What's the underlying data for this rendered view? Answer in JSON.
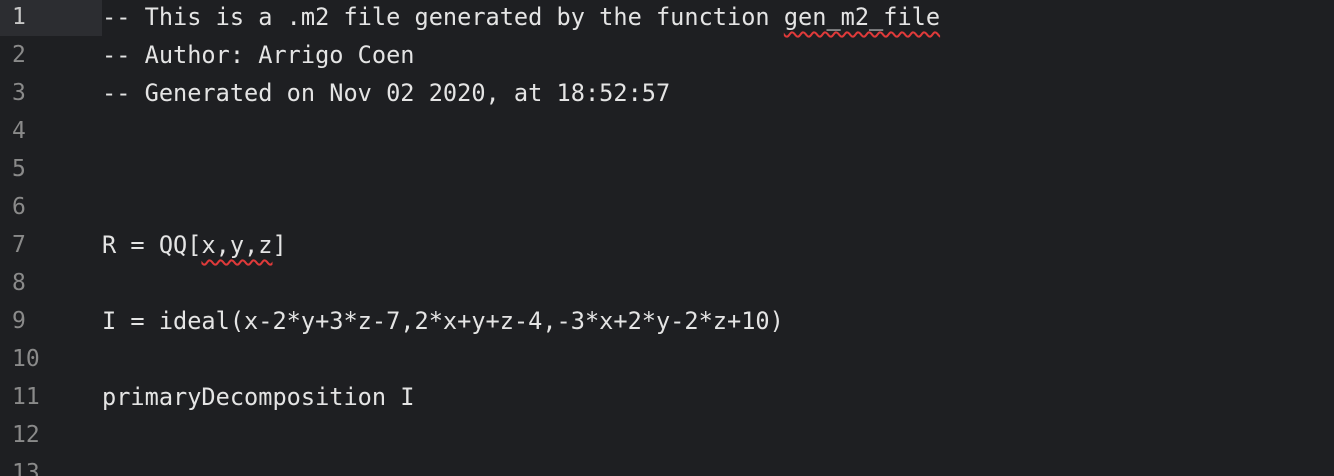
{
  "editor": {
    "lines": [
      {
        "num": "1",
        "pre": "-- This is a .m2 file generated by the function ",
        "flag": "gen_m2_file",
        "post": ""
      },
      {
        "num": "2",
        "pre": "-- Author: Arrigo Coen",
        "flag": "",
        "post": ""
      },
      {
        "num": "3",
        "pre": "-- Generated on Nov 02 2020, at 18:52:57",
        "flag": "",
        "post": ""
      },
      {
        "num": "4",
        "pre": "",
        "flag": "",
        "post": ""
      },
      {
        "num": "5",
        "pre": "",
        "flag": "",
        "post": ""
      },
      {
        "num": "6",
        "pre": "",
        "flag": "",
        "post": ""
      },
      {
        "num": "7",
        "pre": "R = QQ[",
        "flag": "x,y,z",
        "post": "]"
      },
      {
        "num": "8",
        "pre": "",
        "flag": "",
        "post": ""
      },
      {
        "num": "9",
        "pre": "I = ideal(x-2*y+3*z-7,2*x+y+z-4,-3*x+2*y-2*z+10)",
        "flag": "",
        "post": ""
      },
      {
        "num": "10",
        "pre": "",
        "flag": "",
        "post": ""
      },
      {
        "num": "11",
        "pre": "primaryDecomposition I",
        "flag": "",
        "post": ""
      },
      {
        "num": "12",
        "pre": "",
        "flag": "",
        "post": ""
      },
      {
        "num": "13",
        "pre": "",
        "flag": "",
        "post": ""
      }
    ]
  },
  "colors": {
    "background": "#1e1f22",
    "text": "#e4e4e4",
    "line_number": "#8a8a8a",
    "current_line": "#2c2d31",
    "spellcheck_underline": "#e03a3a"
  }
}
